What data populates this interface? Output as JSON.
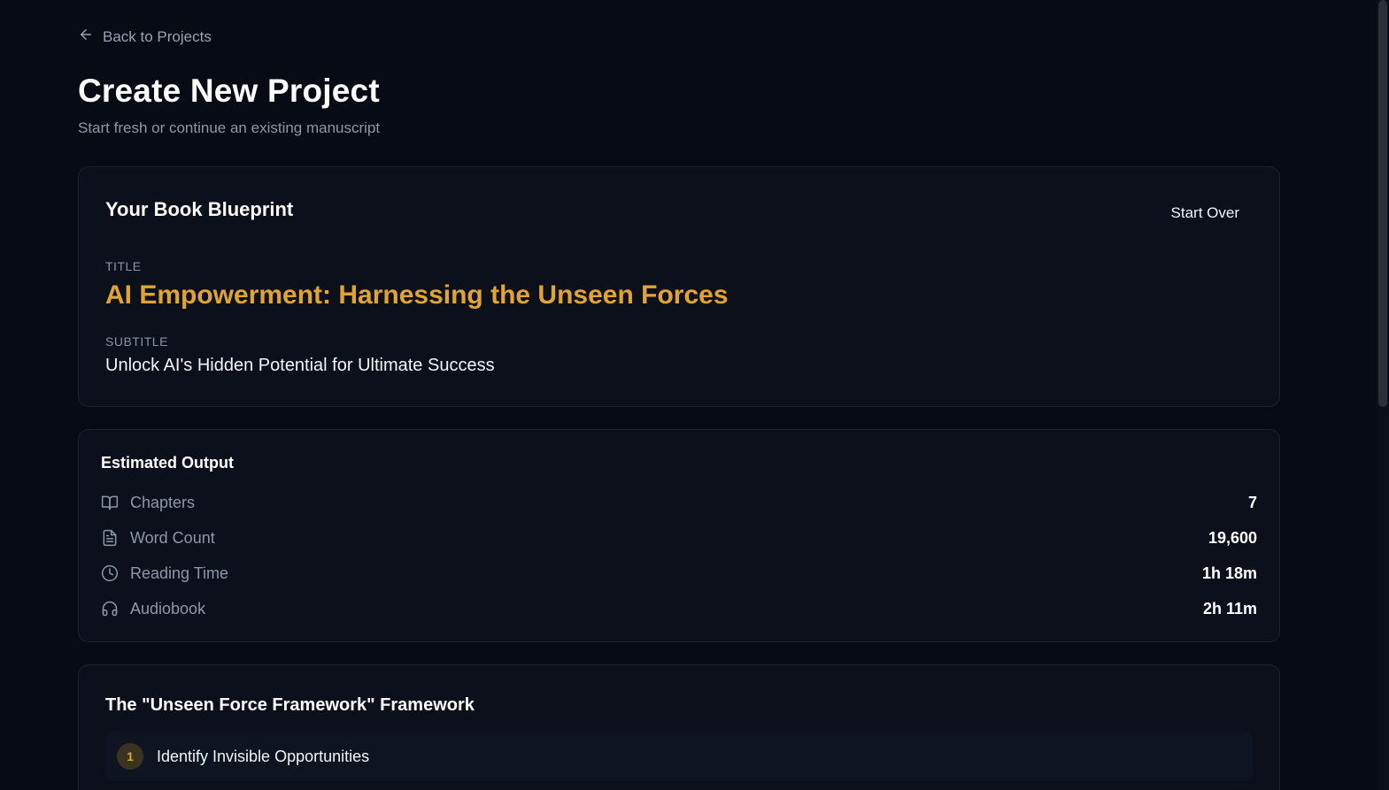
{
  "nav": {
    "back_label": "Back to Projects"
  },
  "header": {
    "title": "Create New Project",
    "subtitle": "Start fresh or continue an existing manuscript"
  },
  "blueprint": {
    "heading": "Your Book Blueprint",
    "start_over_label": "Start Over",
    "title_label": "TITLE",
    "title_value": "AI Empowerment: Harnessing the Unseen Forces",
    "subtitle_label": "SUBTITLE",
    "subtitle_value": "Unlock AI's Hidden Potential for Ultimate Success"
  },
  "estimated_output": {
    "heading": "Estimated Output",
    "stats": [
      {
        "icon": "book-open-icon",
        "label": "Chapters",
        "value": "7"
      },
      {
        "icon": "document-icon",
        "label": "Word Count",
        "value": "19,600"
      },
      {
        "icon": "clock-icon",
        "label": "Reading Time",
        "value": "1h 18m"
      },
      {
        "icon": "headphones-icon",
        "label": "Audiobook",
        "value": "2h 11m"
      }
    ]
  },
  "framework": {
    "heading": "The \"Unseen Force Framework\" Framework",
    "items": [
      {
        "number": "1",
        "label": "Identify Invisible Opportunities"
      }
    ]
  },
  "colors": {
    "background": "#070b14",
    "card": "#0b101b",
    "accent": "#e2a431",
    "muted_text": "#8e97a6"
  }
}
